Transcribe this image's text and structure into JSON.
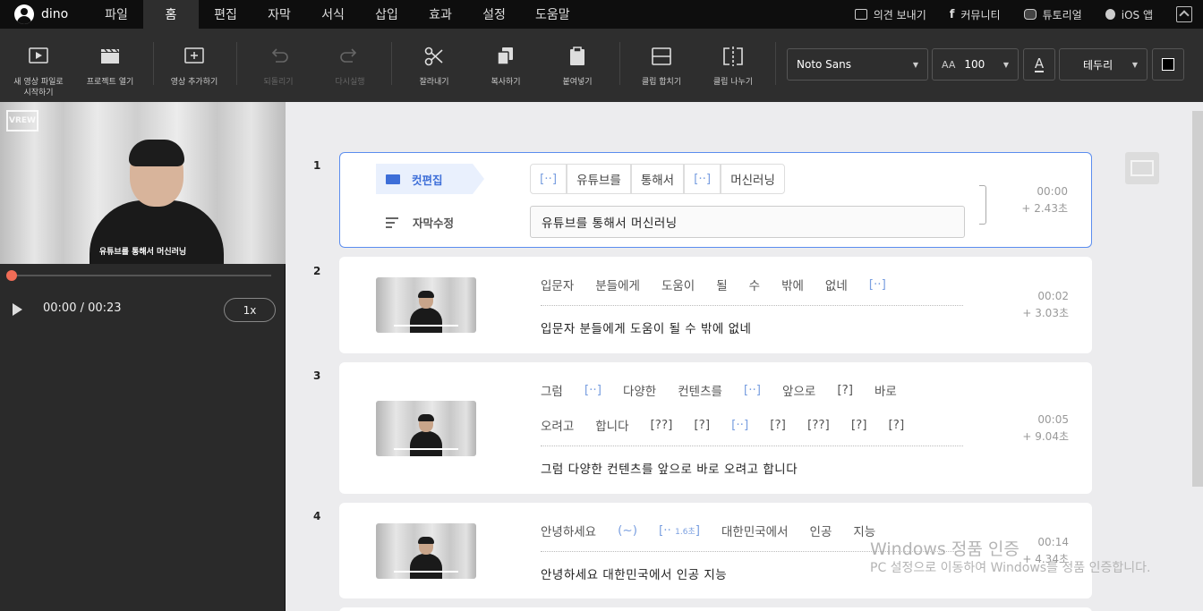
{
  "menubar": {
    "user": "dino",
    "items": [
      "파일",
      "홈",
      "편집",
      "자막",
      "서식",
      "삽입",
      "효과",
      "설정",
      "도움말"
    ],
    "active": "홈",
    "right_links": [
      "의견 보내기",
      "커뮤니티",
      "튜토리얼",
      "iOS 앱"
    ]
  },
  "toolbar": {
    "new_project": "새 영상 파일로 시작하기",
    "open_project": "프로젝트 열기",
    "add_video": "영상 추가하기",
    "undo": "되돌리기",
    "redo": "다시실행",
    "cut": "잘라내기",
    "copy": "복사하기",
    "paste": "붙여넣기",
    "merge_clip": "클립 합치기",
    "split_clip": "클립 나누기",
    "font": "Noto Sans",
    "font_size": "100",
    "border": "테두리"
  },
  "player": {
    "caption": "유튜브를 통해서 머신러닝",
    "time": "00:00 / 00:23",
    "speed": "1x",
    "watermark": "VREW"
  },
  "clips": [
    {
      "num": "1",
      "cut_edit": "컷편집",
      "subtitle_edit": "자막수정",
      "words": [
        "[··]",
        "유튜브를",
        "통해서",
        "[··]",
        "머신러닝"
      ],
      "subtitle": "유튜브를 통해서 머신러닝",
      "time": "00:00",
      "duration": "+ 2.43초"
    },
    {
      "num": "2",
      "words": [
        "입문자",
        "분들에게",
        "도움이",
        "될",
        "수",
        "밖에",
        "없네",
        "[··]"
      ],
      "subtitle": "입문자 분들에게 도움이 될 수 밖에 없네",
      "time": "00:02",
      "duration": "+ 3.03초"
    },
    {
      "num": "3",
      "words_line1": [
        "그럼",
        "[··]",
        "다양한",
        "컨텐츠를",
        "[··]",
        "앞으로",
        "[?]",
        "바로"
      ],
      "words_line2": [
        "오려고",
        "합니다",
        "[??]",
        "[?]",
        "[··]",
        "[?]",
        "[??]",
        "[?]",
        "[?]"
      ],
      "subtitle": "그럼 다양한 컨텐츠를 앞으로 바로 오려고 합니다",
      "time": "00:05",
      "duration": "+ 9.04초"
    },
    {
      "num": "4",
      "words": [
        "안녕하세요",
        "(~)",
        "[··",
        "1.6초",
        "]",
        "대한민국에서",
        "인공",
        "지능"
      ],
      "subtitle": "안녕하세요 대한민국에서 인공 지능",
      "time": "00:14",
      "duration": "+ 4.34초"
    }
  ],
  "windows_activation": {
    "title": "Windows 정품 인증",
    "message": "PC 설정으로 이동하여 Windows를 정품 인증합니다."
  },
  "colors": {
    "accent": "#3d6ed8",
    "gap_word": "#7a9fe0",
    "scrub": "#f06c56"
  }
}
